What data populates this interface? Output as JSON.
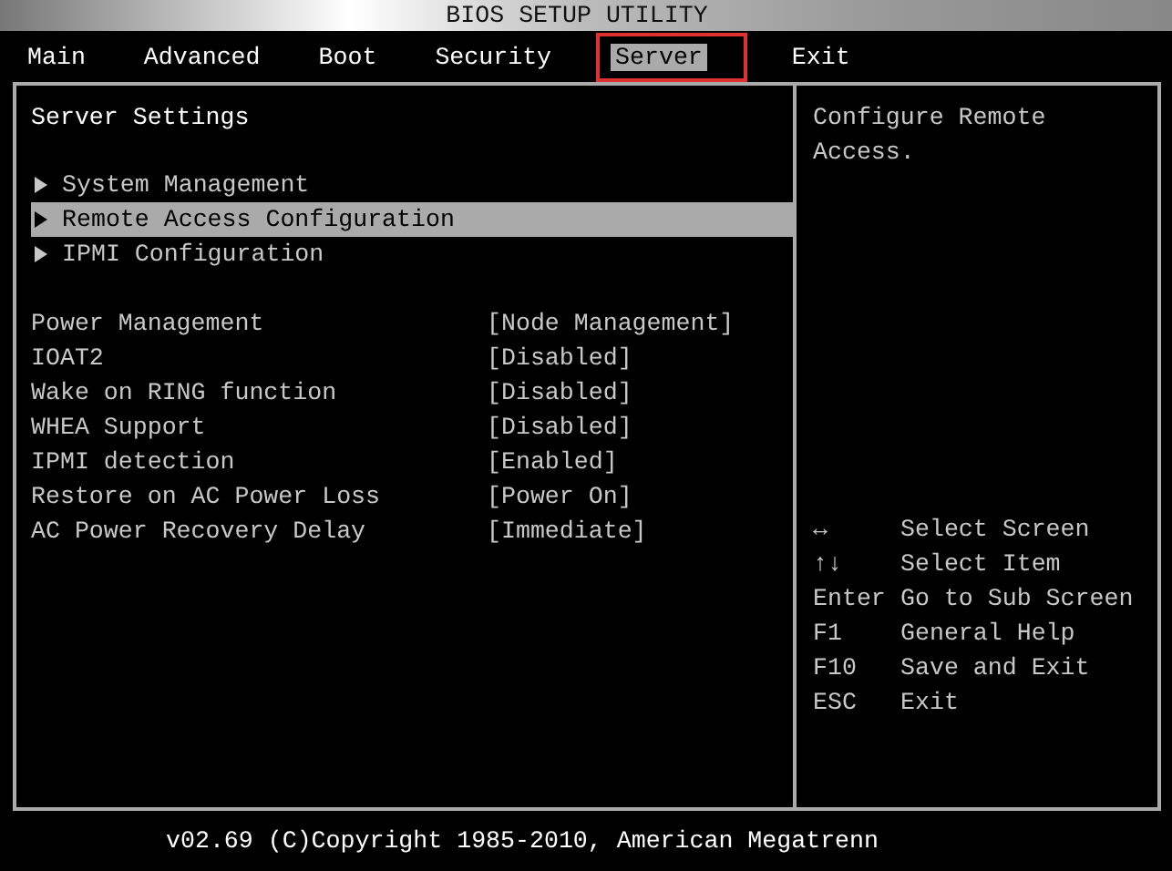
{
  "window": {
    "title": "BIOS SETUP UTILITY"
  },
  "tabs": [
    {
      "label": "Main",
      "selected": false
    },
    {
      "label": "Advanced",
      "selected": false
    },
    {
      "label": "Boot",
      "selected": false
    },
    {
      "label": "Security",
      "selected": false
    },
    {
      "label": "Server",
      "selected": true
    },
    {
      "label": "Exit",
      "selected": false
    }
  ],
  "panel": {
    "title": "Server Settings",
    "items": [
      {
        "kind": "submenu",
        "label": "System Management",
        "selected": false
      },
      {
        "kind": "submenu",
        "label": "Remote Access Configuration",
        "selected": true
      },
      {
        "kind": "submenu",
        "label": "IPMI Configuration",
        "selected": false
      },
      {
        "kind": "setting",
        "label": "Power Management",
        "value": "[Node Management]",
        "selected": false
      },
      {
        "kind": "setting",
        "label": "IOAT2",
        "value": "[Disabled]",
        "selected": false
      },
      {
        "kind": "setting",
        "label": "Wake on RING function",
        "value": "[Disabled]",
        "selected": false
      },
      {
        "kind": "setting",
        "label": "WHEA Support",
        "value": "[Disabled]",
        "selected": false
      },
      {
        "kind": "setting",
        "label": "IPMI detection",
        "value": "[Enabled]",
        "selected": false
      },
      {
        "kind": "setting",
        "label": "Restore on AC Power Loss",
        "value": "[Power On]",
        "selected": false
      },
      {
        "kind": "setting",
        "label": "AC Power Recovery Delay",
        "value": "[Immediate]",
        "selected": false
      }
    ]
  },
  "help": {
    "text": "Configure Remote Access.",
    "keys": [
      {
        "key": "↔",
        "action": "Select Screen"
      },
      {
        "key": "↑↓",
        "action": "Select Item"
      },
      {
        "key": "Enter",
        "action": "Go to Sub Screen"
      },
      {
        "key": "F1",
        "action": "General Help"
      },
      {
        "key": "F10",
        "action": "Save and Exit"
      },
      {
        "key": "ESC",
        "action": "Exit"
      }
    ]
  },
  "status_bar": {
    "text": "v02.69 (C)Copyright 1985-2010, American Megatrenn"
  }
}
